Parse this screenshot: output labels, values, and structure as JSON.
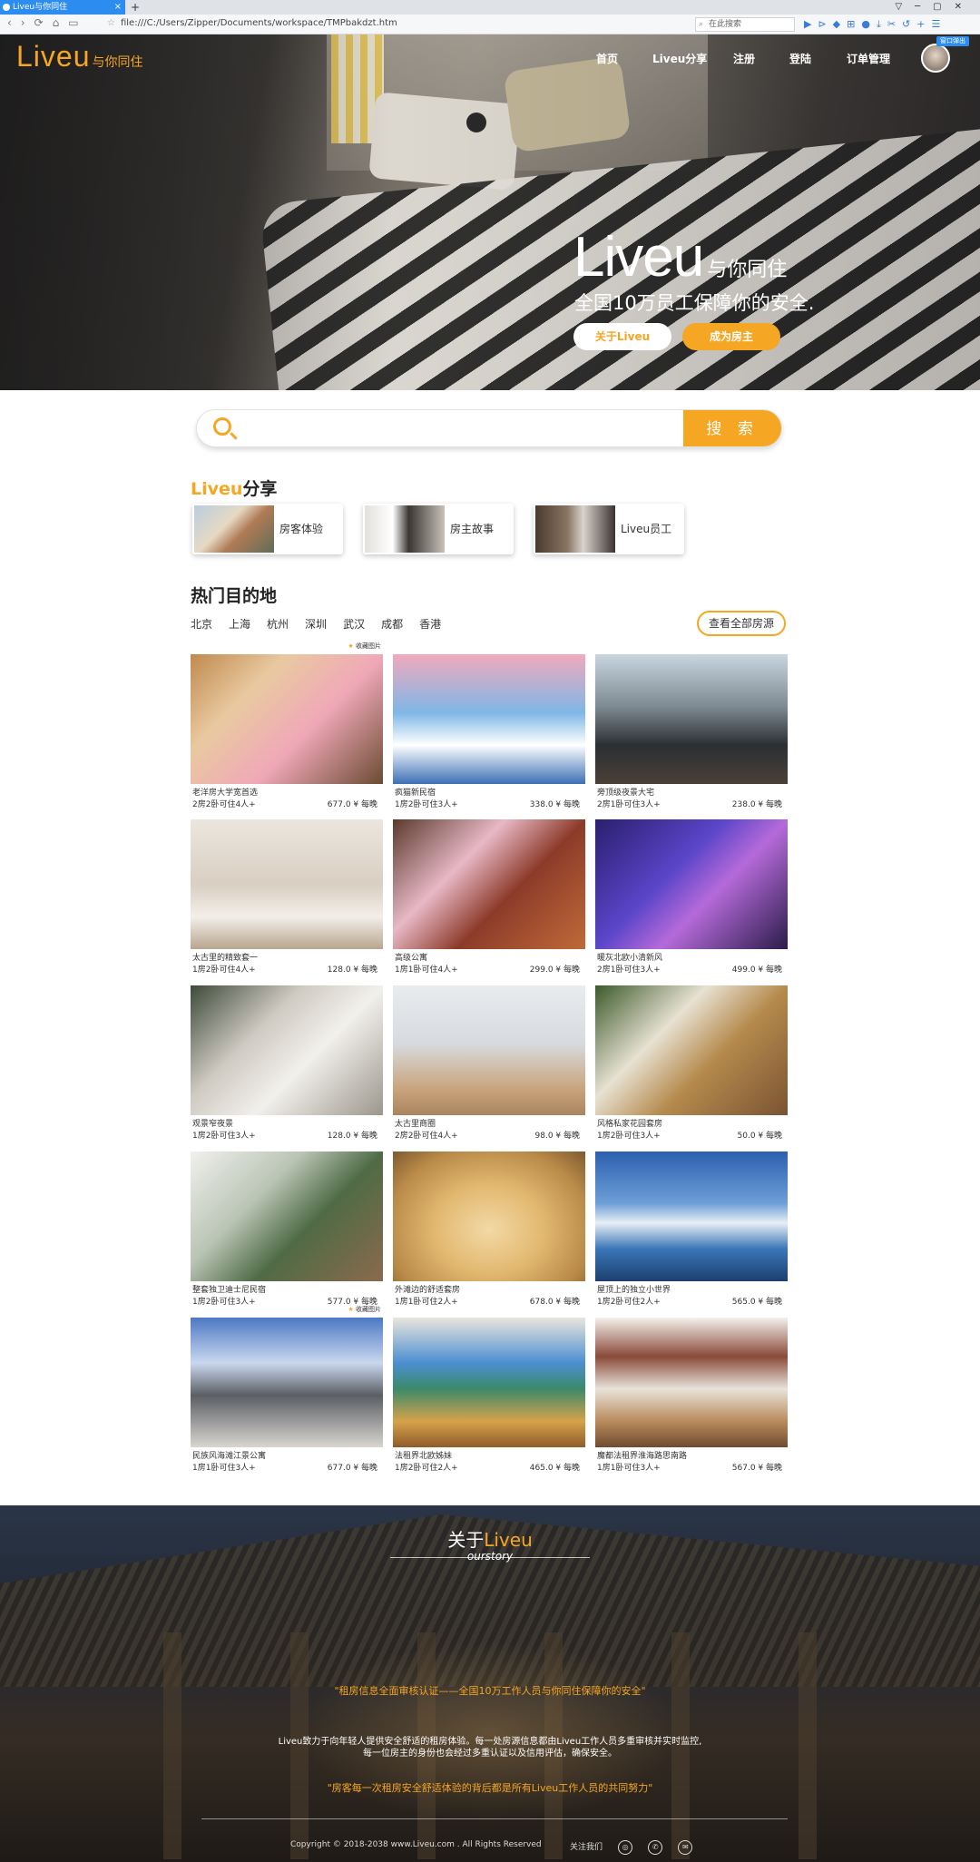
{
  "browser": {
    "tab_title": "Liveu与你同住",
    "url": "file:///C:/Users/Zipper/Documents/workspace/TMPbakdzt.htm",
    "search_placeholder": "在此搜索",
    "badge": "窗口弹出"
  },
  "header": {
    "logo_big": "Liveu",
    "logo_small": "与你同住",
    "nav": [
      "首页",
      "Liveu分享",
      "注册",
      "登陆",
      "订单管理"
    ]
  },
  "hero": {
    "title_big": "Liveu",
    "title_small": "与你同住",
    "subtitle": "全国10万员工保障你的安全.",
    "btn_about": "关于Liveu",
    "btn_host": "成为房主"
  },
  "search": {
    "placeholder": "",
    "button": "搜 索"
  },
  "share": {
    "title_hl": "Liveu",
    "title_rest": "分享",
    "cards": [
      "房客体验",
      "房主故事",
      "Liveu员工"
    ]
  },
  "destinations": {
    "title": "热门目的地",
    "cities": [
      "北京",
      "上海",
      "杭州",
      "深圳",
      "武汉",
      "成都",
      "香港"
    ],
    "view_all": "查看全部房源",
    "fav_label": "收藏图片",
    "listings": [
      {
        "name": "老洋房大学宽首选",
        "meta": "2房2卧可住4人+",
        "price": "677.0 ¥ 每晚"
      },
      {
        "name": "疯猫新民宿",
        "meta": "1房2卧可住3人+",
        "price": "338.0 ¥ 每晚"
      },
      {
        "name": "旁顶级夜景大宅",
        "meta": "2房1卧可住3人+",
        "price": "238.0 ¥ 每晚"
      },
      {
        "name": "太古里的精致套一",
        "meta": "1房2卧可住4人+",
        "price": "128.0 ¥ 每晚"
      },
      {
        "name": "高级公寓",
        "meta": "1房1卧可住4人+",
        "price": "299.0 ¥ 每晚"
      },
      {
        "name": "暖灰北欧小清新风",
        "meta": "2房1卧可住3人+",
        "price": "499.0 ¥ 每晚"
      },
      {
        "name": "观景窄夜景",
        "meta": "1房2卧可住3人+",
        "price": "128.0 ¥ 每晚"
      },
      {
        "name": "太古里商圈",
        "meta": "2房2卧可住4人+",
        "price": "98.0 ¥ 每晚"
      },
      {
        "name": "风格私家花园套房",
        "meta": "1房2卧可住3人+",
        "price": "50.0 ¥ 每晚"
      },
      {
        "name": "整套独卫迪士尼民宿",
        "meta": "1房2卧可住3人+",
        "price": "577.0 ¥ 每晚"
      },
      {
        "name": "外滩边的舒适套房",
        "meta": "1房1卧可住2人+",
        "price": "678.0 ¥ 每晚"
      },
      {
        "name": "屋顶上的独立小世界",
        "meta": "1房2卧可住2人+",
        "price": "565.0 ¥ 每晚"
      },
      {
        "name": "民族风海滩江景公寓",
        "meta": "1房1卧可住3人+",
        "price": "677.0 ¥ 每晚"
      },
      {
        "name": "法租界北欧姊妹",
        "meta": "1房2卧可住2人+",
        "price": "465.0 ¥ 每晚"
      },
      {
        "name": "魔都法租界淮海路思南路",
        "meta": "1房1卧可住3人+",
        "price": "567.0 ¥ 每晚"
      }
    ]
  },
  "about": {
    "title_pre": "关于",
    "title_hl": "Liveu",
    "subtitle": "ourstory",
    "quote1": "\"租房信息全面审核认证——全国10万工作人员与你同住保障你的安全\"",
    "desc1": "Liveu致力于向年轻人提供安全舒适的租房体验。每一处房源信息都由Liveu工作人员多重审核并实时监控,",
    "desc2": "每一位房主的身份也会经过多重认证以及信用评估，确保安全。",
    "quote2": "\"房客每一次租房安全舒适体验的背后都是所有Liveu工作人员的共同努力\"",
    "copyright": "Copyright © 2018-2038 www.Liveu.com . All Rights Reserved",
    "follow": "关注我们"
  },
  "colors": {
    "accent": "#f5a623"
  }
}
